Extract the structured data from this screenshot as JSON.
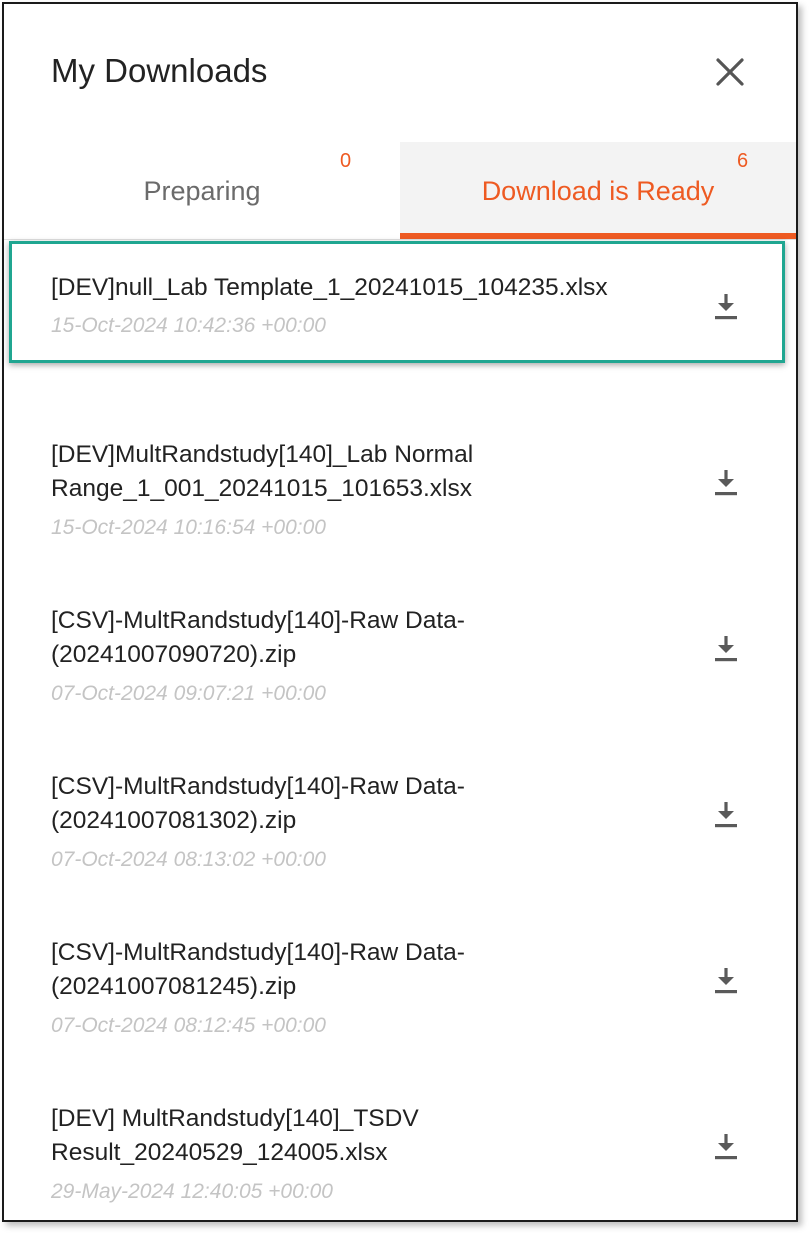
{
  "header": {
    "title": "My Downloads",
    "close_icon": "close-icon"
  },
  "tabs": [
    {
      "label": "Preparing",
      "count": "0",
      "active": false
    },
    {
      "label": "Download is Ready",
      "count": "6",
      "active": true
    }
  ],
  "colors": {
    "accent": "#ee5a22",
    "highlight": "#20a691",
    "date": "#c4c4c4"
  },
  "downloads": [
    {
      "name_lines": [
        "[DEV]null_Lab Template_1_20241015_104235.xlsx"
      ],
      "date": "15-Oct-2024 10:42:36 +00:00",
      "icon": "download-icon"
    },
    {
      "name_lines": [
        "[DEV]MultRandstudy[140]_Lab Normal",
        "Range_1_001_20241015_101653.xlsx"
      ],
      "date": "15-Oct-2024 10:16:54 +00:00",
      "icon": "download-icon"
    },
    {
      "name_lines": [
        "[CSV]-MultRandstudy[140]-Raw Data-",
        "(20241007090720).zip"
      ],
      "date": "07-Oct-2024 09:07:21 +00:00",
      "icon": "download-icon"
    },
    {
      "name_lines": [
        "[CSV]-MultRandstudy[140]-Raw Data-",
        "(20241007081302).zip"
      ],
      "date": "07-Oct-2024 08:13:02 +00:00",
      "icon": "download-icon"
    },
    {
      "name_lines": [
        "[CSV]-MultRandstudy[140]-Raw Data-",
        "(20241007081245).zip"
      ],
      "date": "07-Oct-2024 08:12:45 +00:00",
      "icon": "download-icon"
    },
    {
      "name_lines": [
        "[DEV] MultRandstudy[140]_TSDV",
        "Result_20240529_124005.xlsx"
      ],
      "date": "29-May-2024 12:40:05 +00:00",
      "icon": "download-icon"
    }
  ]
}
